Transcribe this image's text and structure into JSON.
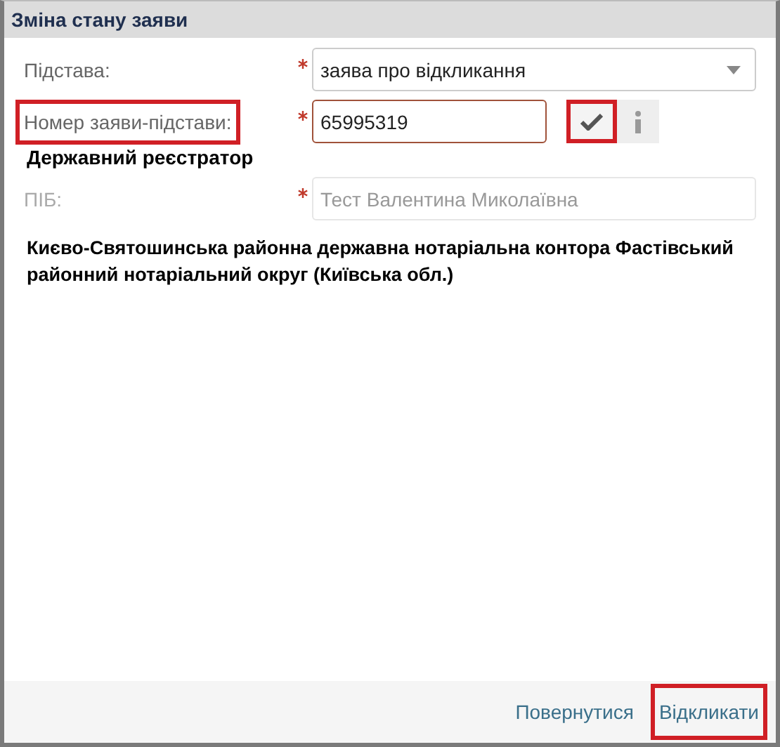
{
  "window": {
    "title": "Зміна стану заяви"
  },
  "fields": [
    {
      "kind": "select",
      "label": "Підстава:",
      "required": true,
      "value": "заява про відкликання",
      "highlighted": false,
      "disabled": false
    },
    {
      "kind": "input",
      "label": "Номер заяви-підстави:",
      "required": true,
      "value": "65995319",
      "highlighted": true,
      "disabled": false,
      "check_highlighted": true
    }
  ],
  "registrar": {
    "heading": "Державний реєстратор",
    "field": {
      "label": "ПІБ:",
      "required": true,
      "value": "Тест Валентина Миколаївна",
      "disabled": true
    },
    "office": "Києво-Святошинська районна державна нотаріальна контора Фастівський районний нотаріальний округ (Київська обл.)"
  },
  "buttons": [
    {
      "label": "Повернутися",
      "highlighted": false
    },
    {
      "label": "Відкликати",
      "highlighted": true
    }
  ]
}
